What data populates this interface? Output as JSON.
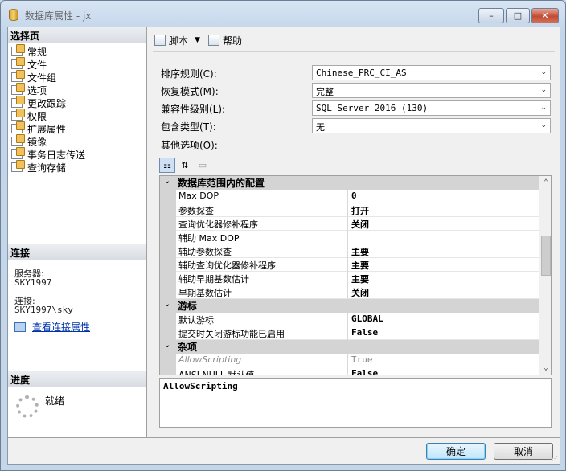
{
  "window": {
    "title": "数据库属性 - jx"
  },
  "caption_buttons": {
    "minimize": "–",
    "maximize": "□",
    "close": "✕"
  },
  "left": {
    "select_page_header": "选择页",
    "nav_items": [
      "常规",
      "文件",
      "文件组",
      "选项",
      "更改跟踪",
      "权限",
      "扩展属性",
      "镜像",
      "事务日志传送",
      "查询存储"
    ],
    "connection_header": "连接",
    "server_label": "服务器:",
    "server_value": "SKY1997",
    "connection_label": "连接:",
    "connection_value": "SKY1997\\sky",
    "view_connection_link": "查看连接属性",
    "progress_header": "进度",
    "progress_status": "就绪"
  },
  "toolbar": {
    "script_label": "脚本",
    "help_label": "帮助"
  },
  "properties": {
    "collation_label": "排序规则(C):",
    "collation_value": "Chinese_PRC_CI_AS",
    "recovery_label": "恢复模式(M):",
    "recovery_value": "完整",
    "compat_label": "兼容性级别(L):",
    "compat_value": "SQL Server 2016 (130)",
    "containment_label": "包含类型(T):",
    "containment_value": "无",
    "other_options_label": "其他选项(O):"
  },
  "grid": {
    "rows": [
      {
        "kind": "cat",
        "toggle": "⌄",
        "name": "数据库范围内的配置"
      },
      {
        "kind": "prop",
        "name": "Max DOP",
        "value": "0"
      },
      {
        "kind": "prop",
        "name": "参数探查",
        "value": "打开"
      },
      {
        "kind": "prop",
        "name": "查询优化器修补程序",
        "value": "关闭"
      },
      {
        "kind": "prop",
        "name": "辅助 Max DOP",
        "value": ""
      },
      {
        "kind": "prop",
        "name": "辅助参数探查",
        "value": "主要"
      },
      {
        "kind": "prop",
        "name": "辅助查询优化器修补程序",
        "value": "主要"
      },
      {
        "kind": "prop",
        "name": "辅助早期基数估计",
        "value": "主要"
      },
      {
        "kind": "prop",
        "name": "早期基数估计",
        "value": "关闭"
      },
      {
        "kind": "cat",
        "toggle": "⌄",
        "name": "游标"
      },
      {
        "kind": "prop",
        "name": "默认游标",
        "value": "GLOBAL"
      },
      {
        "kind": "prop",
        "name": "提交时关闭游标功能已启用",
        "value": "False"
      },
      {
        "kind": "cat",
        "toggle": "⌄",
        "name": "杂项"
      },
      {
        "kind": "prop",
        "name": "AllowScripting",
        "value": "True",
        "dim": true
      },
      {
        "kind": "prop",
        "name": "ANSI NULL 默认值",
        "value": "False"
      }
    ]
  },
  "description": {
    "text": "AllowScripting"
  },
  "buttons": {
    "ok": "确定",
    "cancel": "取消"
  }
}
